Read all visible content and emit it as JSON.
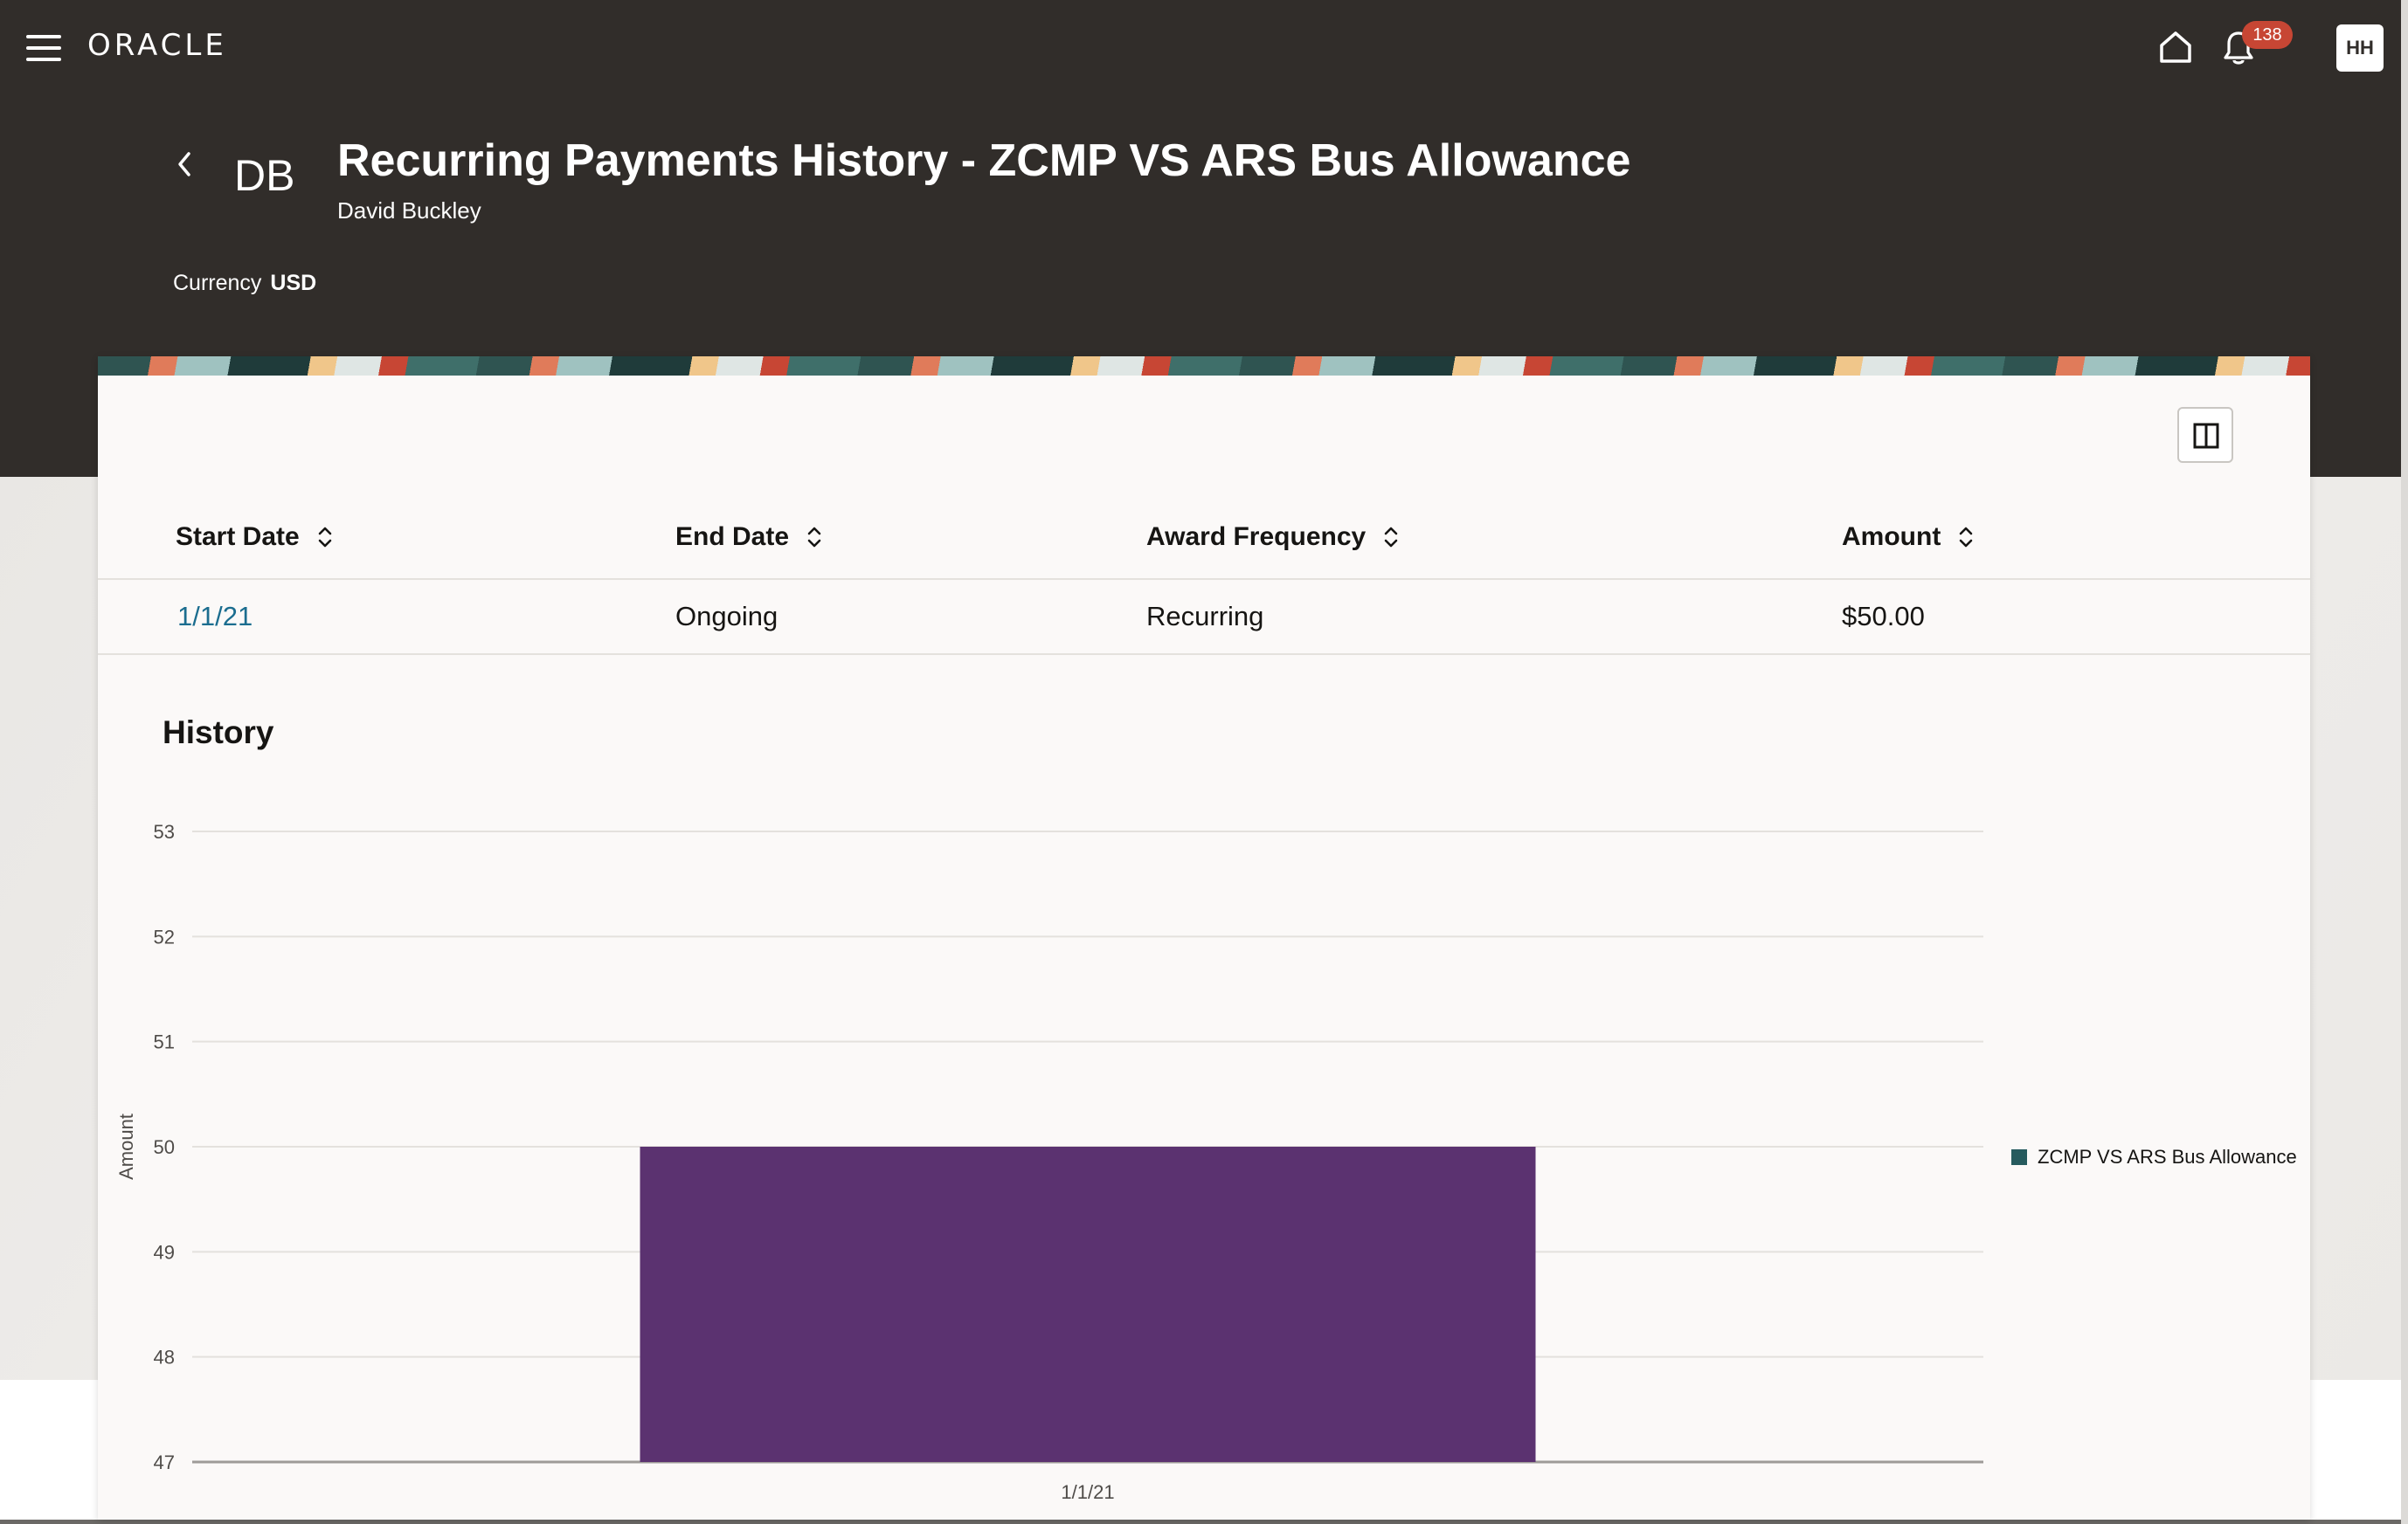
{
  "app": {
    "brand": "ORACLE"
  },
  "notifications": {
    "count": "138"
  },
  "user": {
    "initials": "HH"
  },
  "header": {
    "initials": "DB",
    "title": "Recurring Payments History - ZCMP VS ARS Bus Allowance",
    "person_name": "David Buckley",
    "currency_label": "Currency",
    "currency_value": "USD"
  },
  "table": {
    "columns": [
      "Start Date",
      "End Date",
      "Award Frequency",
      "Amount"
    ],
    "rows": [
      {
        "start_date": "1/1/21",
        "end_date": "Ongoing",
        "award_frequency": "Recurring",
        "amount": "$50.00"
      }
    ]
  },
  "history": {
    "title": "History"
  },
  "colors": {
    "header_bg": "#312d2a",
    "bar": "#5b3270",
    "link": "#1b6d8f",
    "legend_swatch": "#265b5e",
    "badge": "#c74634"
  },
  "chart_data": {
    "type": "bar",
    "categories": [
      "1/1/21"
    ],
    "series": [
      {
        "name": "ZCMP VS ARS Bus Allowance",
        "values": [
          50
        ]
      }
    ],
    "ylabel": "Amount",
    "xlabel": "",
    "ylim": [
      47,
      53
    ],
    "yticks": [
      47,
      48,
      49,
      50,
      51,
      52,
      53
    ],
    "grid": true,
    "legend_position": "right"
  }
}
